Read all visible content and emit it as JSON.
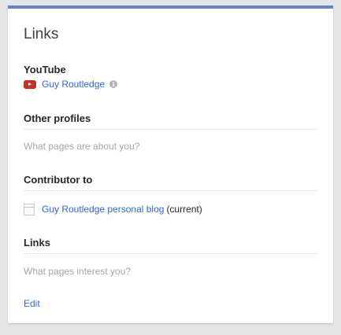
{
  "card": {
    "title": "Links",
    "accent_color": "#6d82c6"
  },
  "youtube": {
    "heading": "YouTube",
    "channel_name": "Guy Routledge",
    "icon": "youtube-icon",
    "info_icon": "info-icon",
    "info_glyph": "i"
  },
  "other_profiles": {
    "heading": "Other profiles",
    "placeholder": "What pages are about you?"
  },
  "contributor_to": {
    "heading": "Contributor to",
    "items": [
      {
        "label": "Guy Routledge personal blog",
        "tag": "(current)",
        "icon": "page-icon"
      }
    ]
  },
  "links": {
    "heading": "Links",
    "placeholder": "What pages interest you?"
  },
  "actions": {
    "edit_label": "Edit"
  }
}
